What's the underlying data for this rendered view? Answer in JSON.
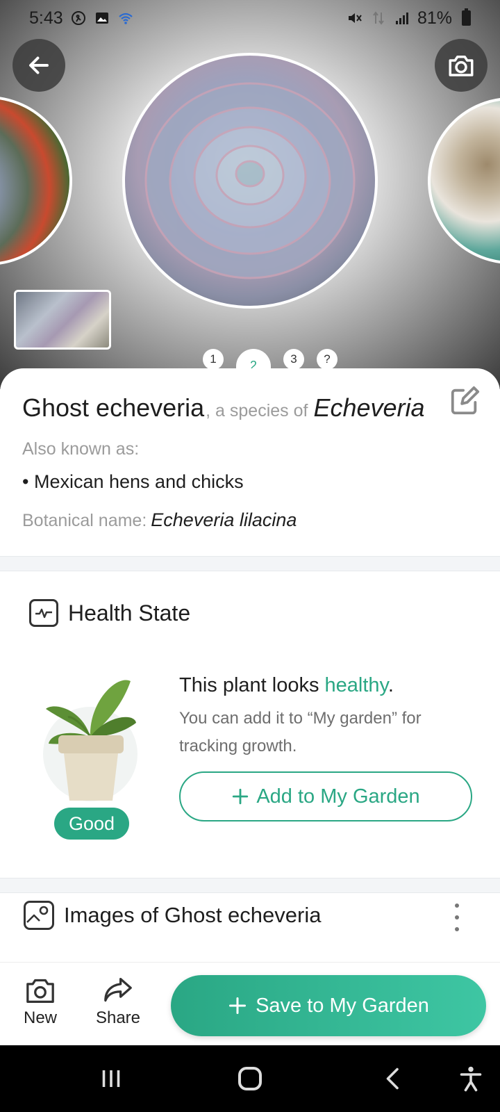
{
  "status_bar": {
    "time": "5:43",
    "battery": "81%",
    "icons": [
      "activity-icon",
      "image-icon",
      "wifi-icon",
      "mute-icon",
      "data-icon",
      "signal-icon",
      "battery-icon"
    ]
  },
  "gallery": {
    "pages": [
      "1",
      "2",
      "3",
      "?"
    ],
    "active_page": "2"
  },
  "plant": {
    "common_name": "Ghost echeveria",
    "species_of_label": ", a species of",
    "genus": "Echeveria",
    "also_known_as_label": "Also known as:",
    "also_known_as": [
      "Mexican hens and chicks"
    ],
    "botanical_label": "Botanical name:",
    "botanical_name": "Echeveria lilacina"
  },
  "health": {
    "title": "Health State",
    "badge": "Good",
    "line1_prefix": "This plant looks ",
    "status_word": "healthy",
    "line1_suffix": ".",
    "description": "You can add it to “My garden” for tracking growth.",
    "add_button": "Add to My Garden"
  },
  "images_section": {
    "title": "Images of Ghost echeveria"
  },
  "action_bar": {
    "new_label": "New",
    "share_label": "Share",
    "save_label": "Save to My Garden"
  },
  "colors": {
    "accent": "#2aa784",
    "accent_light": "#3ec6a3"
  }
}
